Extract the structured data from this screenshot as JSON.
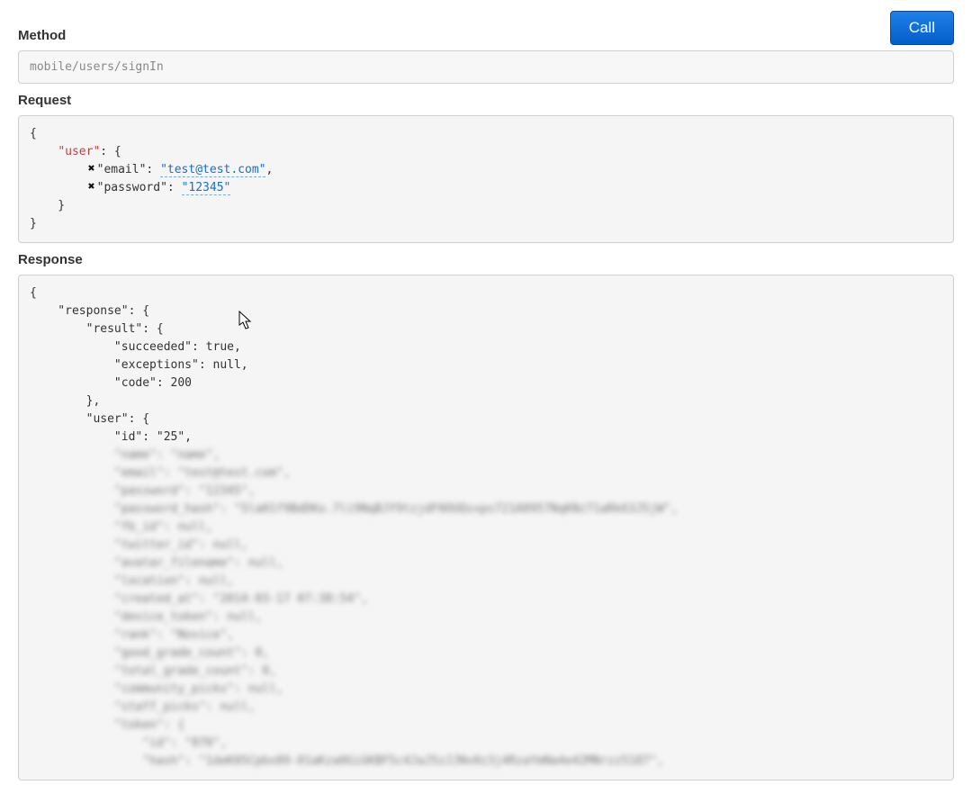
{
  "labels": {
    "method": "Method",
    "request": "Request",
    "response": "Response"
  },
  "buttons": {
    "call": "Call"
  },
  "method_value": "mobile/users/signIn",
  "request": {
    "root_key": "\"user\"",
    "fields": [
      {
        "key": "\"email\"",
        "value": "\"test@test.com\""
      },
      {
        "key": "\"password\"",
        "value": "\"12345\""
      }
    ]
  },
  "response": {
    "lines_clear": [
      "{",
      "    \"response\": {",
      "        \"result\": {",
      "            \"succeeded\": true,",
      "            \"exceptions\": null,",
      "            \"code\": 200",
      "        },",
      "        \"user\": {",
      "            \"id\": \"25\","
    ],
    "lines_blurred": [
      "            \"name\": \"name\",",
      "            \"email\": \"test@test.com\",",
      "            \"password\": \"12345\",",
      "            \"password_hash\": \"5la01f9BdDKo.7li9NqBJY9tzjdF0OUQsxps721A8957NqKNz71aRk63J5jW\",",
      "            \"fb_id\": null,",
      "            \"twitter_id\": null,",
      "            \"avatar_filename\": null,",
      "            \"location\": null,",
      "            \"created_at\": \"2014-03-17 07:38:54\",",
      "            \"device_token\": null,",
      "            \"rank\": \"Novice\",",
      "            \"good_grade_count\": 0,",
      "            \"total_grade_count\": 0,",
      "            \"community_picks\": null,",
      "            \"staff_picks\": null,",
      "            \"token\": {",
      "                \"id\": \"870\",",
      "                \"hash\": \"1deK05Cpbx89-01aKza0GiGKBF5c4JaJ5zJJNv0z3j4RzaYmNa4e42MNrzz5187\","
    ]
  }
}
